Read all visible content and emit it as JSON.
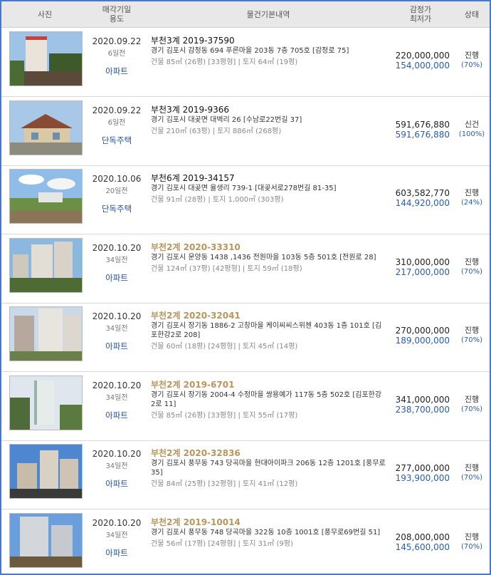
{
  "header": {
    "photo": "사진",
    "date_line1": "매각기일",
    "date_line2": "용도",
    "basic": "물건기본내역",
    "price_line1": "감정가",
    "price_line2": "최저가",
    "status": "상태"
  },
  "rows": [
    {
      "date": "2020.09.22",
      "days": "6일전",
      "usage": "아파트",
      "title": "부천3계 2019-37590",
      "gold": false,
      "addr": "경기 김포시 감정동 694 푸른마을 203동 7층 705호 [감정로 75]",
      "area": "건물 85㎡ (26평) [33평형]  |  토지 64㎡ (19평)",
      "appraisal": "220,000,000",
      "minimum": "154,000,000",
      "status": "진행",
      "pct": "(70%)"
    },
    {
      "date": "2020.09.22",
      "days": "6일전",
      "usage": "단독주택",
      "title": "부천3계 2019-9366",
      "gold": false,
      "addr": "경기 김포시 대곶면 대벽리 26 [수남로22번길 37]",
      "area": "건물 210㎡ (63평)  |  토지 886㎡ (268평)",
      "appraisal": "591,676,880",
      "minimum": "591,676,880",
      "status": "신건",
      "pct": "(100%)"
    },
    {
      "date": "2020.10.06",
      "days": "20일전",
      "usage": "단독주택",
      "title": "부천6계 2019-34157",
      "gold": false,
      "addr": "경기 김포시 대곶면 율생리 739-1 [대곶서로278번길 81-35]",
      "area": "건물 91㎡ (28평)  |  토지 1,000㎡ (303평)",
      "appraisal": "603,582,770",
      "minimum": "144,920,000",
      "status": "진행",
      "pct": "(24%)"
    },
    {
      "date": "2020.10.20",
      "days": "34일전",
      "usage": "아파트",
      "title": "부천2계 2020-33310",
      "gold": true,
      "addr": "경기 김포시 운양동 1438 ,1436 전원마을 103동 5층 501호 [전원로 28]",
      "area": "건물 124㎡ (37평) [42평형]  |  토지 59㎡ (18평)",
      "appraisal": "310,000,000",
      "minimum": "217,000,000",
      "status": "진행",
      "pct": "(70%)"
    },
    {
      "date": "2020.10.20",
      "days": "34일전",
      "usage": "아파트",
      "title": "부천2계 2020-32041",
      "gold": true,
      "addr": "경기 김포시 장기동 1886-2 고창마을 케이씨씨스위첸 403동 1층 101호 [김포한강2로 208]",
      "area": "건물 60㎡ (18평) [24평형]  |  토지 45㎡ (14평)",
      "appraisal": "270,000,000",
      "minimum": "189,000,000",
      "status": "진행",
      "pct": "(70%)"
    },
    {
      "date": "2020.10.20",
      "days": "34일전",
      "usage": "아파트",
      "title": "부천2계 2019-6701",
      "gold": true,
      "addr": "경기 김포시 장기동 2004-4 수정마을 쌍용예가 117동 5층 502호 [김포한강2로 11]",
      "area": "건물 85㎡ (26평) [33평형]  |  토지 55㎡ (17평)",
      "appraisal": "341,000,000",
      "minimum": "238,700,000",
      "status": "진행",
      "pct": "(70%)"
    },
    {
      "date": "2020.10.20",
      "days": "34일전",
      "usage": "아파트",
      "title": "부천2계 2020-32836",
      "gold": true,
      "addr": "경기 김포시 풍무동 743 당곡마을 현대아이파크 206동 12층 1201호 [풍무로 35]",
      "area": "건물 84㎡ (25평) [32평형]  |  토지 41㎡ (12평)",
      "appraisal": "277,000,000",
      "minimum": "193,900,000",
      "status": "진행",
      "pct": "(70%)"
    },
    {
      "date": "2020.10.20",
      "days": "34일전",
      "usage": "아파트",
      "title": "부천2계 2019-10014",
      "gold": true,
      "addr": "경기 김포시 풍무동 748 당곡마을 322동 10층 1001호 [풍무로69번길 51]",
      "area": "건물 56㎡ (17평) [24평형]  |  토지 31㎡ (9평)",
      "appraisal": "208,000,000",
      "minimum": "145,600,000",
      "status": "진행",
      "pct": "(70%)"
    }
  ]
}
